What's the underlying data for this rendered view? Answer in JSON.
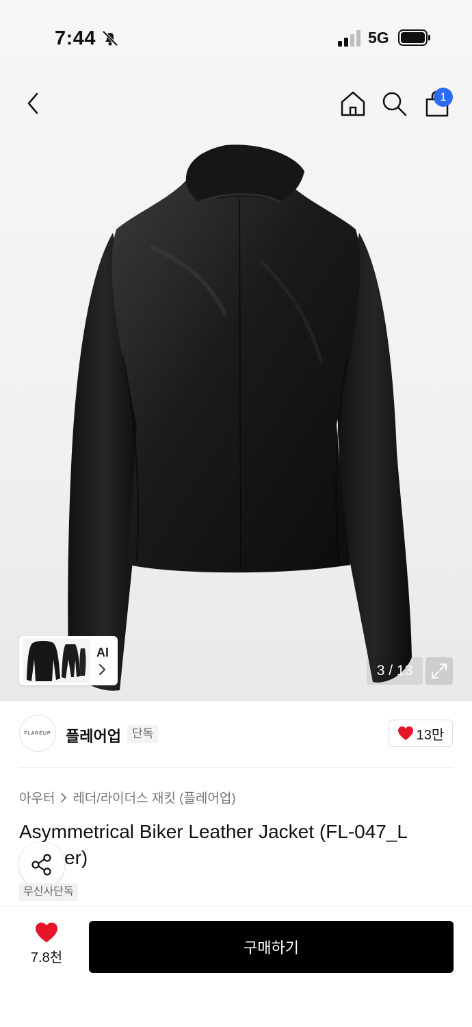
{
  "status_bar": {
    "time": "7:44",
    "network": "5G"
  },
  "nav": {
    "cart_count": "1"
  },
  "gallery": {
    "ai_label": "AI",
    "counter": "3 / 13"
  },
  "brand": {
    "logo_text": "FLAREUP",
    "name": "플레어업",
    "exclusive_label": "단독",
    "likes": "13만"
  },
  "breadcrumb": {
    "category": "아우터",
    "subcategory": "레더/라이더스 재킷 (플레어업)"
  },
  "product": {
    "title_line1": "Asymmetrical Biker Leather Jacket (FL-047_L",
    "title_line2": "er)",
    "badge": "무신사단독"
  },
  "bottom_bar": {
    "wish_count": "7.8천",
    "buy_label": "구매하기"
  },
  "colors": {
    "accent_blue": "#2c6bf0",
    "heart_red": "#e8152a",
    "buy_black": "#000000"
  },
  "icons": [
    "bell-slash-icon",
    "signal-icon",
    "battery-icon",
    "back-icon",
    "home-icon",
    "search-icon",
    "cart-icon",
    "chevron-right-icon",
    "expand-icon",
    "heart-icon",
    "share-icon"
  ]
}
